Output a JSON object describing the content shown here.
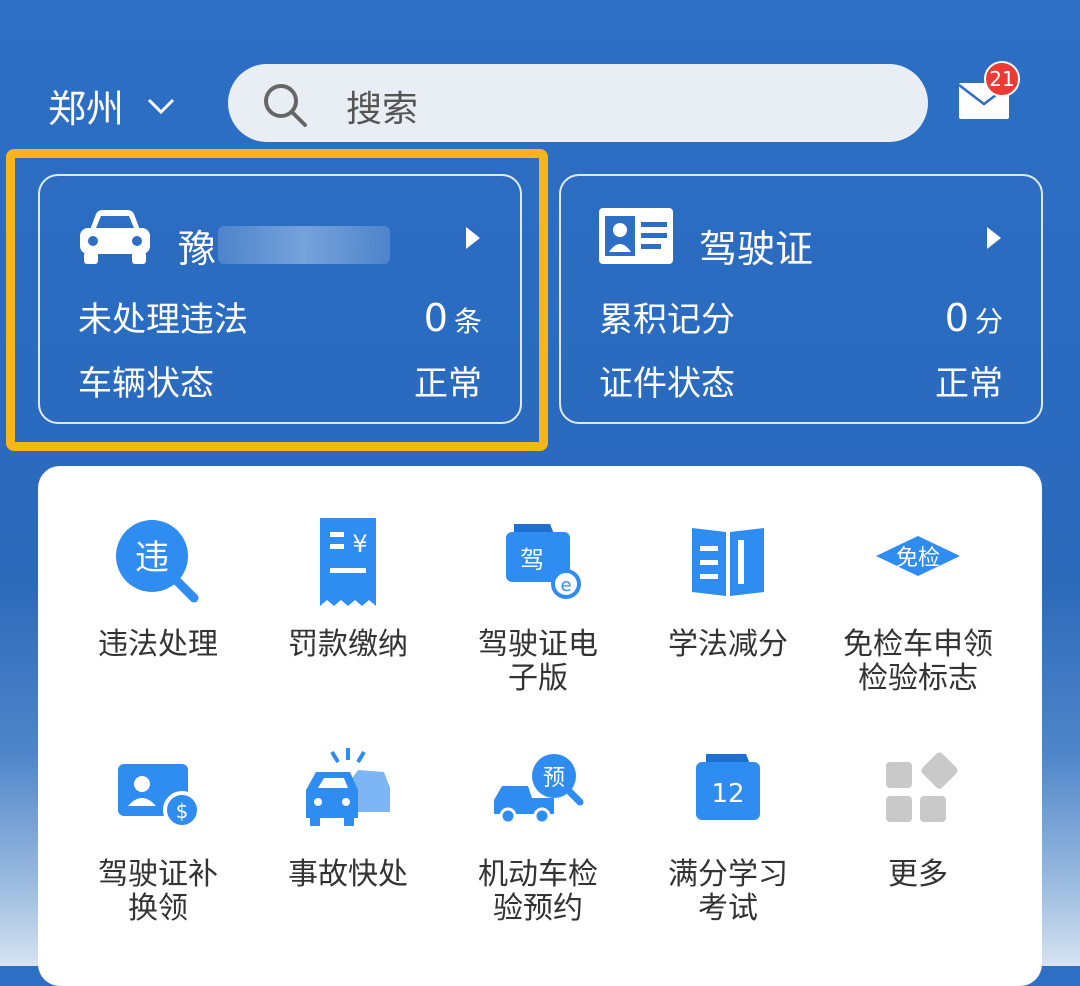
{
  "header": {
    "city": "郑州",
    "search_placeholder": "搜索",
    "message_badge": "21"
  },
  "vehicle_card": {
    "plate_prefix": "豫",
    "rows": [
      {
        "label": "未处理违法",
        "value": "0",
        "unit": "条"
      },
      {
        "label": "车辆状态",
        "value": "正常",
        "unit": ""
      }
    ]
  },
  "license_card": {
    "title": "驾驶证",
    "rows": [
      {
        "label": "累积记分",
        "value": "0",
        "unit": "分"
      },
      {
        "label": "证件状态",
        "value": "正常",
        "unit": ""
      }
    ]
  },
  "services": [
    {
      "label": "违法处理",
      "icon": "violation-icon"
    },
    {
      "label": "罚款缴纳",
      "icon": "fine-receipt-icon"
    },
    {
      "label": "驾驶证电\n子版",
      "icon": "e-license-icon"
    },
    {
      "label": "学法减分",
      "icon": "book-icon"
    },
    {
      "label": "免检车申领\n检验标志",
      "icon": "inspection-exempt-icon"
    },
    {
      "label": "驾驶证补\n换领",
      "icon": "license-replace-icon"
    },
    {
      "label": "事故快处",
      "icon": "accident-icon"
    },
    {
      "label": "机动车检\n验预约",
      "icon": "inspection-appointment-icon"
    },
    {
      "label": "满分学习\n考试",
      "icon": "calendar-12-icon"
    },
    {
      "label": "更多",
      "icon": "more-grid-icon"
    }
  ],
  "colors": {
    "primary": "#2d6fc4",
    "icon_blue": "#2f8cf0",
    "highlight": "#f7b518",
    "badge": "#ec3b35"
  }
}
